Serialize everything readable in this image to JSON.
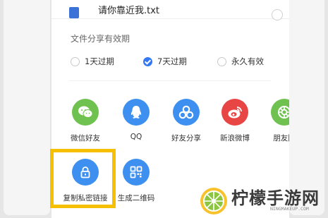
{
  "file": {
    "name": "请你靠近我.txt"
  },
  "validity": {
    "title": "文件分享有效期",
    "options": [
      {
        "label": "1天过期",
        "selected": false
      },
      {
        "label": "7天过期",
        "selected": true
      },
      {
        "label": "永久有效",
        "selected": false
      }
    ]
  },
  "share": {
    "row1": [
      {
        "label": "微信好友",
        "icon": "wechat-icon",
        "color": "#6fc24f"
      },
      {
        "label": "QQ",
        "icon": "qq-icon",
        "color": "#3d8ff0"
      },
      {
        "label": "好友分享",
        "icon": "friend-share-icon",
        "color": "#3d8ff0"
      },
      {
        "label": "新浪微博",
        "icon": "weibo-icon",
        "color": "#e84545"
      },
      {
        "label": "朋友圈",
        "icon": "moments-icon",
        "color": "#6fc24f"
      }
    ],
    "row2": [
      {
        "label": "复制私密链接",
        "icon": "lock-icon",
        "color": "#3d8ff0"
      },
      {
        "label": "生成二维码",
        "icon": "qr-code-icon",
        "color": "#3d8ff0"
      }
    ]
  },
  "watermark": {
    "brand": "柠檬手游网",
    "url": "NINGMAKEUP.COM",
    "brand_color": "#f39a1e"
  },
  "highlight_color": "#f6c000"
}
